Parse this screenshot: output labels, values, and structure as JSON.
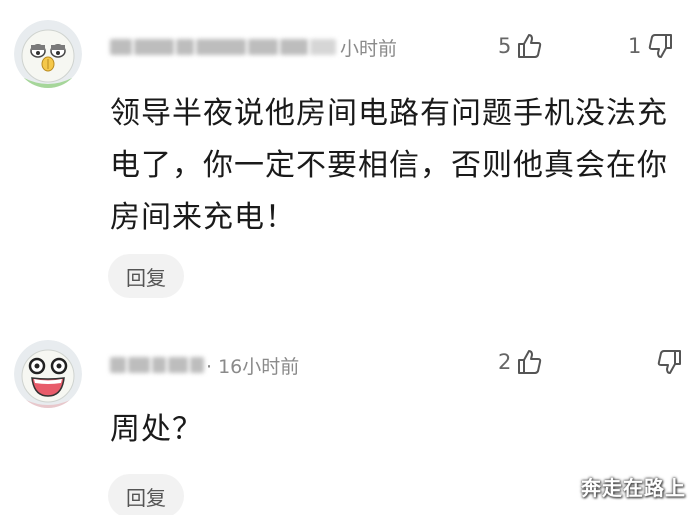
{
  "comments": [
    {
      "time": "小时前",
      "likes": "5",
      "dislikes": "1",
      "body": "领导半夜说他房间电路有问题手机没法充电了，你一定不要相信，否则他真会在你房间来充电！",
      "reply_label": "回复"
    },
    {
      "time": "· 16小时前",
      "likes": "2",
      "dislikes": "",
      "body": "周处？",
      "reply_label": "回复"
    }
  ],
  "watermark": "奔走在路上",
  "icons": {
    "like": "thumbs-up-icon",
    "dislike": "thumbs-down-icon",
    "avatar1": "sleepy-face-avatar",
    "avatar2": "laughing-face-avatar"
  }
}
